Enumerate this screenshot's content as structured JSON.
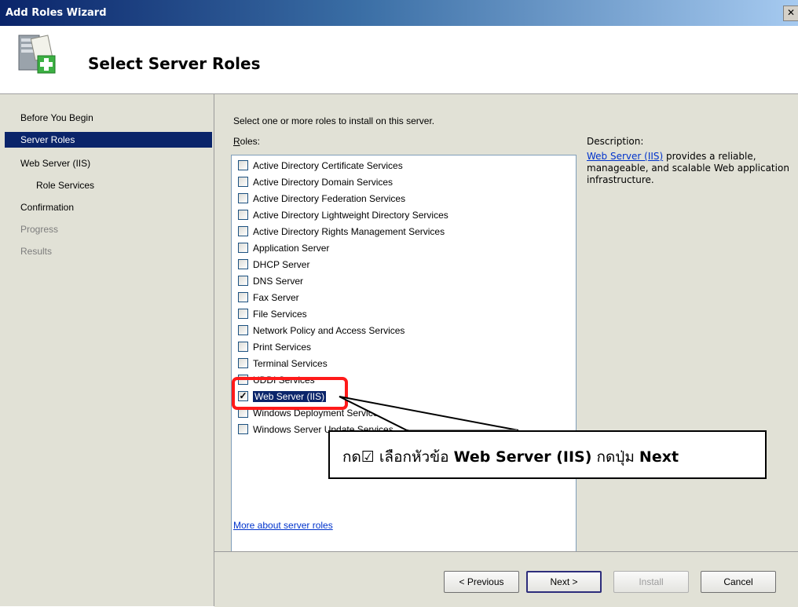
{
  "window": {
    "title": "Add Roles Wizard",
    "close_glyph": "✕"
  },
  "header": {
    "heading": "Select Server Roles",
    "icon": "server-add-icon"
  },
  "nav": {
    "items": [
      {
        "label": "Before You Begin",
        "state": "normal"
      },
      {
        "label": "Server Roles",
        "state": "selected"
      },
      {
        "label": "Web Server (IIS)",
        "state": "normal"
      },
      {
        "label": "Role Services",
        "state": "sub"
      },
      {
        "label": "Confirmation",
        "state": "normal"
      },
      {
        "label": "Progress",
        "state": "disabled"
      },
      {
        "label": "Results",
        "state": "disabled"
      }
    ]
  },
  "main": {
    "instruction": "Select one or more roles to install on this server.",
    "roles_label_prefix": "R",
    "roles_label_rest": "oles:",
    "roles": [
      {
        "label": "Active Directory Certificate Services",
        "checked": false
      },
      {
        "label": "Active Directory Domain Services",
        "checked": false
      },
      {
        "label": "Active Directory Federation Services",
        "checked": false
      },
      {
        "label": "Active Directory Lightweight Directory Services",
        "checked": false
      },
      {
        "label": "Active Directory Rights Management Services",
        "checked": false
      },
      {
        "label": "Application Server",
        "checked": false
      },
      {
        "label": "DHCP Server",
        "checked": false
      },
      {
        "label": "DNS Server",
        "checked": false
      },
      {
        "label": "Fax Server",
        "checked": false
      },
      {
        "label": "File Services",
        "checked": false
      },
      {
        "label": "Network Policy and Access Services",
        "checked": false
      },
      {
        "label": "Print Services",
        "checked": false
      },
      {
        "label": "Terminal Services",
        "checked": false
      },
      {
        "label": "UDDI Services",
        "checked": false
      },
      {
        "label": "Web Server (IIS)",
        "checked": true
      },
      {
        "label": "Windows Deployment Services",
        "checked": false
      },
      {
        "label": "Windows Server Update Services",
        "checked": false
      }
    ],
    "description_heading": "Description:",
    "description_link": "Web Server (IIS)",
    "description_text": " provides a reliable, manageable, and scalable Web application infrastructure.",
    "more_link": "More about server roles"
  },
  "buttons": {
    "previous": "< Previous",
    "next": "Next >",
    "install": "Install",
    "cancel": "Cancel"
  },
  "annotation": {
    "text_prefix": "กด",
    "checkbox_glyph": "☑",
    "text_middle": " เลือกหัวข้อ ",
    "text_bold1": "Web Server (IIS)",
    "text_middle2": " กดปุ่ม ",
    "text_bold2": "Next",
    "highlight_color": "#ff1a1a"
  }
}
